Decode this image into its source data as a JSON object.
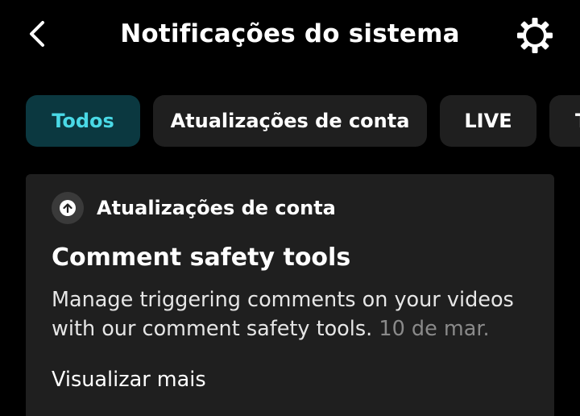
{
  "header": {
    "title": "Notificações do sistema",
    "back_icon": "chevron-left-icon",
    "settings_icon": "gear-icon"
  },
  "tabs": [
    {
      "label": "Todos",
      "active": true
    },
    {
      "label": "Atualizações de conta",
      "active": false
    },
    {
      "label": "LIVE",
      "active": false
    },
    {
      "label": "T",
      "active": false
    }
  ],
  "notification": {
    "category_icon": "arrow-up-circle-icon",
    "category": "Atualizações de conta",
    "title": "Comment safety tools",
    "body": "Manage triggering comments on your videos with our comment safety tools.",
    "date": "10 de mar.",
    "view_more": "Visualizar mais"
  },
  "colors": {
    "background": "#000000",
    "surface": "#1f1f1f",
    "active_tab_bg": "#0b3840",
    "active_tab_text": "#4ad9e6",
    "muted_text": "#8a8a8a"
  }
}
